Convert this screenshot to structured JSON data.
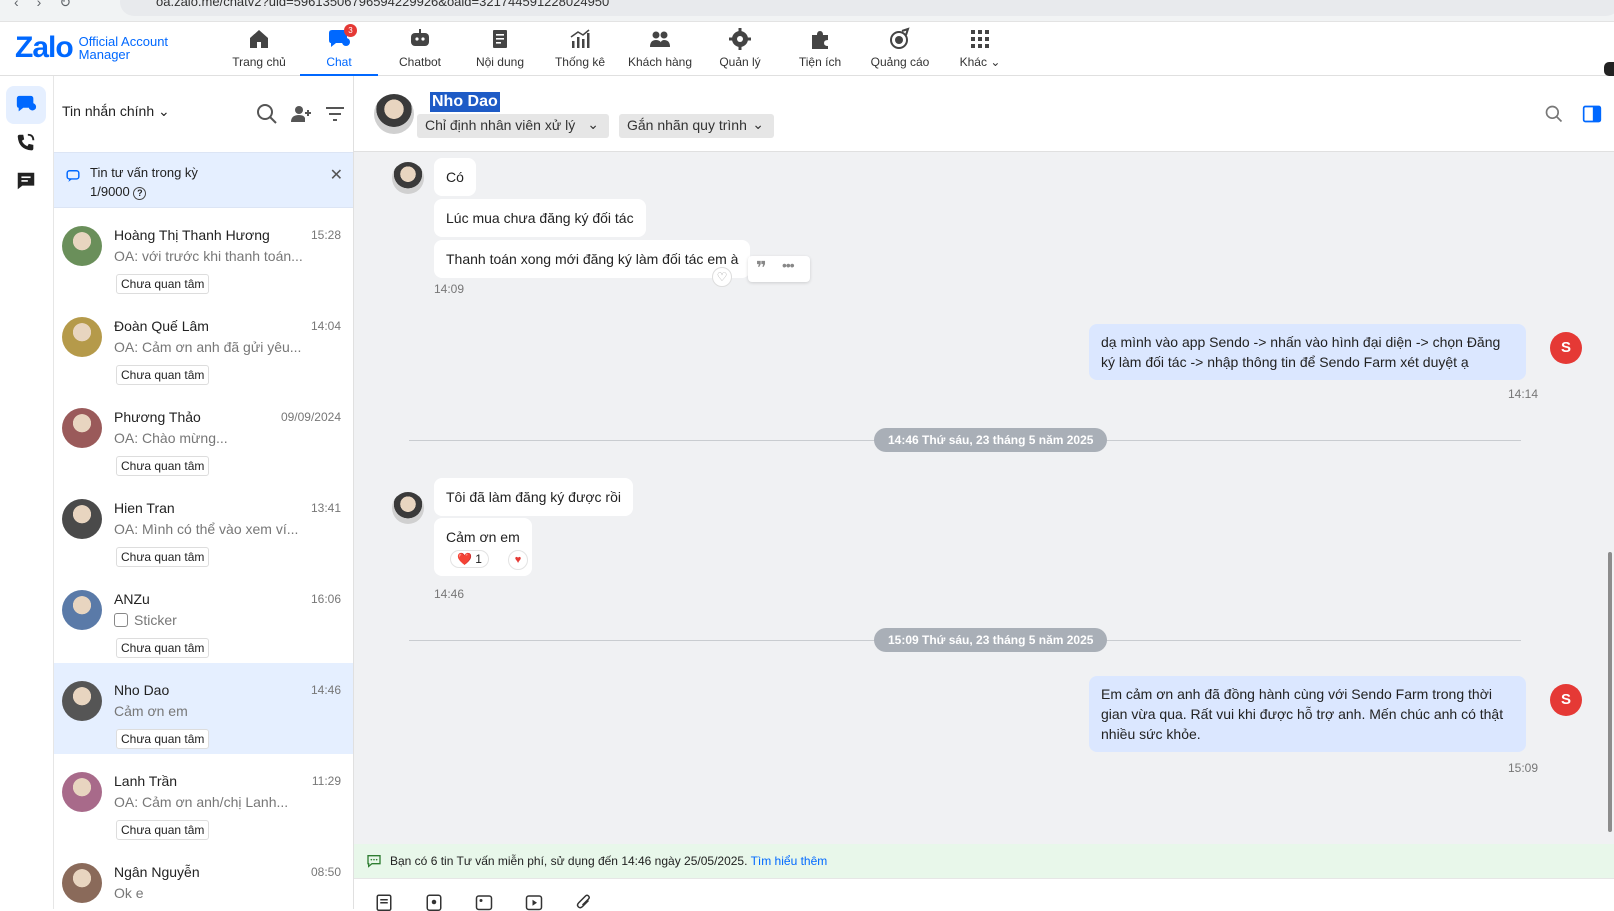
{
  "browser": {
    "url": "oa.zalo.me/chatv2?uid=59613506796594229926&oaid=321744591228024950"
  },
  "logo": {
    "brand": "Zalo",
    "line1": "Official Account",
    "line2": "Manager"
  },
  "nav": {
    "items": [
      {
        "label": "Trang chủ",
        "icon": "home-icon"
      },
      {
        "label": "Chat",
        "icon": "chat-icon",
        "badge": "3",
        "active": true
      },
      {
        "label": "Chatbot",
        "icon": "chatbot-icon"
      },
      {
        "label": "Nội dung",
        "icon": "content-icon"
      },
      {
        "label": "Thống kê",
        "icon": "stats-icon"
      },
      {
        "label": "Khách hàng",
        "icon": "customers-icon"
      },
      {
        "label": "Quản lý",
        "icon": "gear-icon"
      },
      {
        "label": "Tiện ích",
        "icon": "puzzle-icon"
      },
      {
        "label": "Quảng cáo",
        "icon": "ads-icon"
      },
      {
        "label": "Khác",
        "icon": "grid-icon"
      }
    ]
  },
  "conv_panel": {
    "title": "Tin nhắn chính",
    "quota": {
      "line1": "Tin tư vấn trong kỳ",
      "line2": "1/9000"
    },
    "items": [
      {
        "name": "Hoàng Thị Thanh Hương",
        "time": "15:28",
        "prefix": "OA:",
        "preview": "với trước khi thanh toán...",
        "tag": "Chưa quan tâm",
        "color": "#6a8f5a"
      },
      {
        "name": "Đoàn Quế Lâm",
        "time": "14:04",
        "prefix": "OA:",
        "preview": "Cảm ơn anh đã gửi yêu...",
        "tag": "Chưa quan tâm",
        "color": "#b59a4a"
      },
      {
        "name": "Phương Thảo",
        "time": "09/09/2024",
        "prefix": "OA:",
        "preview": "Chào mừng...",
        "tag": "Chưa quan tâm",
        "color": "#9a5a5a"
      },
      {
        "name": "Hien Tran",
        "time": "13:41",
        "prefix": "OA:",
        "preview": "Mình có thể vào xem ví...",
        "tag": "Chưa quan tâm",
        "color": "#4a4a4a"
      },
      {
        "name": "ANZu",
        "time": "16:06",
        "prefix": "",
        "preview": "Sticker",
        "tag": "Chưa quan tâm",
        "color": "#5a7aa8"
      },
      {
        "name": "Nho Dao",
        "time": "14:46",
        "prefix": "",
        "preview": "Cảm ơn em",
        "tag": "Chưa quan tâm",
        "color": "#555",
        "active": true
      },
      {
        "name": "Lanh Trần",
        "time": "11:29",
        "prefix": "OA:",
        "preview": "Cảm ơn anh/chị Lanh...",
        "tag": "Chưa quan tâm",
        "color": "#a86a8a"
      },
      {
        "name": "Ngân Nguyễn",
        "time": "08:50",
        "prefix": "",
        "preview": "Ok e",
        "tag": "",
        "color": "#8a6a5a"
      }
    ]
  },
  "chat": {
    "contact_name": "Nho Dao",
    "assign_label": "Chỉ định nhân viên xử lý",
    "tag_label": "Gắn nhãn quy trình",
    "messages": {
      "m1": "Có",
      "m2": "Lúc mua chưa đăng ký đối tác",
      "m3": "Thanh toán xong mới đăng ký làm đối tác em à",
      "t1": "14:09",
      "r1": "dạ mình vào app Sendo -> nhấn vào hình đại diện -> chọn Đăng ký làm đối tác -> nhập thông tin để Sendo Farm xét duyệt ạ",
      "t2": "14:14",
      "sep1": "14:46 Thứ sáu, 23 tháng 5 năm 2025",
      "m4": "Tôi đã làm đăng ký được rồi",
      "m5": "Cảm ơn em",
      "reaction": "❤️ 1",
      "t3": "14:46",
      "sep2": "15:09 Thứ sáu, 23 tháng 5 năm 2025",
      "r2": "Em cảm ơn anh đã đồng hành cùng với Sendo Farm trong thời gian vừa qua. Rất vui khi được hỗ trợ anh. Mến chúc anh có thật nhiều sức khỏe.",
      "t4": "15:09"
    }
  },
  "notice": {
    "text": "Bạn có 6 tin Tư vấn miễn phí, sử dụng đến 14:46 ngày 25/05/2025.",
    "link": "Tìm hiểu thêm"
  },
  "colors": {
    "accent": "#0068ff",
    "badge": "#e53935",
    "outgoing": "#dbe7ff",
    "chat_bg": "#f0f1f3"
  }
}
